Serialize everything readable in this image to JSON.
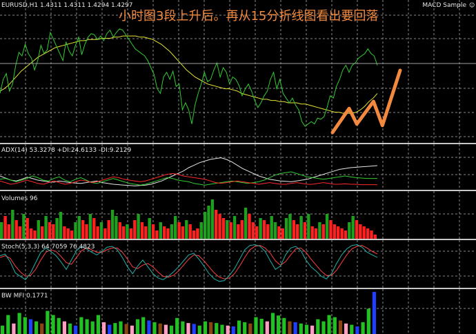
{
  "header": {
    "symbol_line": "EURUSD,H1  1.4311 1.4311 1.4294 1.4297",
    "expert_label": "MACD Sample",
    "annotation": "小时图3段上升后。再从15分折线图看出要回落"
  },
  "indicators": {
    "adx_label": "ADX(14) 53.3278 +DI:24.6133 -DI:9.2129",
    "volumes_label": "Volumes 96",
    "stoch_label": "Stoch(5,3,3) 64.7059 76.4823",
    "bwmfi_label": "BW MFI 0.1771"
  },
  "colors": {
    "price": "#32cd32",
    "ma": "#e6e632",
    "arrow": "#f2893f",
    "adx_main": "#e6e6e6",
    "plus_di": "#32cd32",
    "minus_di": "#ff2a2a",
    "vol_up": "#1ea01e",
    "vol_down": "#ff2020",
    "stoch_main": "#20b2aa",
    "stoch_signal": "#ff4040",
    "bw_green": "#22c022",
    "bw_brown": "#8b4513",
    "bw_blue": "#2040ff",
    "bw_pink": "#ff9ec0",
    "grid": "#8a8a8a"
  },
  "chart_data": [
    {
      "type": "line",
      "title": "EURUSD,H1",
      "y_range_note": "relative scale 0 (bottom) to 100 (top)",
      "series": [
        {
          "values": [
            38,
            50,
            55,
            40,
            46,
            62,
            73,
            70,
            80,
            72,
            68,
            58,
            66,
            79,
            72,
            75,
            90,
            84,
            78,
            72,
            66,
            82,
            74,
            70,
            79,
            86,
            71,
            80,
            86,
            89,
            88,
            84,
            87,
            83,
            89,
            92,
            86,
            90,
            93,
            92,
            88,
            84,
            80,
            76,
            74,
            72,
            70,
            66,
            60,
            54,
            42,
            38,
            52,
            56,
            50,
            57,
            44,
            46,
            24,
            30,
            24,
            12,
            28,
            38,
            46,
            56,
            48,
            50,
            58,
            64,
            52,
            60,
            56,
            46,
            52,
            50,
            45,
            36,
            42,
            46,
            40,
            32,
            26,
            30,
            36,
            40,
            50,
            56,
            42,
            50,
            38,
            34,
            30,
            34,
            28,
            24,
            14,
            10,
            12,
            14,
            12,
            17,
            16,
            18,
            26,
            36,
            34,
            44,
            50,
            58,
            62,
            56,
            62,
            64,
            68,
            70,
            72,
            76,
            72,
            70,
            62
          ]
        },
        {
          "values": [
            40,
            42,
            45,
            49,
            53,
            57,
            60,
            63,
            66,
            69,
            71,
            73,
            75,
            77,
            78,
            79,
            80,
            81,
            82,
            83,
            83,
            84,
            84,
            84,
            85,
            85,
            85,
            86,
            86,
            87,
            87,
            87,
            87,
            86,
            86,
            85,
            84,
            82,
            80,
            77,
            74,
            70,
            66,
            62,
            58,
            55,
            52,
            50,
            48,
            46,
            45,
            44,
            43,
            42,
            42,
            41,
            40,
            38,
            37,
            36,
            35,
            34,
            33,
            33,
            32,
            32,
            31,
            31,
            30,
            30,
            30,
            29,
            29,
            28,
            27,
            26,
            25,
            24,
            23,
            22,
            22,
            21,
            21,
            21,
            22,
            24,
            27,
            31,
            34,
            38
          ]
        }
      ],
      "arrow_path": [
        [
          0,
          0
        ],
        [
          15,
          34
        ],
        [
          22,
          12
        ],
        [
          37,
          44
        ],
        [
          45,
          10
        ],
        [
          61,
          88
        ]
      ]
    },
    {
      "type": "line",
      "title": "ADX(14)",
      "series": [
        {
          "values": [
            30,
            25,
            20,
            18,
            22,
            27,
            24,
            20,
            18,
            16,
            15,
            18,
            16,
            14,
            13,
            12,
            14,
            16,
            18,
            14,
            12,
            10,
            9,
            8,
            7,
            6,
            7,
            8,
            10,
            14,
            18,
            24,
            30,
            36,
            42,
            50,
            56,
            62,
            66,
            70,
            72,
            74,
            70,
            64,
            56,
            48,
            42,
            36,
            30,
            26,
            22,
            20,
            18,
            17,
            16,
            18,
            20,
            22,
            26,
            30,
            34,
            38,
            42,
            46,
            48,
            50,
            51,
            52,
            53,
            54,
            55
          ]
        },
        {
          "values": [
            22,
            24,
            20,
            16,
            20,
            24,
            30,
            26,
            20,
            18,
            24,
            28,
            20,
            16,
            22,
            26,
            20,
            14,
            12,
            16,
            20,
            24,
            20,
            16,
            12,
            10,
            8,
            10,
            14,
            18,
            22,
            26,
            24,
            20,
            18,
            16,
            12,
            10,
            8,
            10,
            12,
            14,
            16,
            18,
            16,
            14,
            12,
            14,
            16,
            20,
            26,
            32,
            36,
            38,
            40,
            36,
            32,
            28,
            26,
            24,
            22,
            24,
            26,
            28,
            30,
            28,
            26,
            25,
            24,
            24,
            24
          ]
        },
        {
          "values": [
            18,
            14,
            10,
            12,
            16,
            20,
            16,
            12,
            10,
            14,
            18,
            14,
            10,
            12,
            16,
            20,
            18,
            14,
            16,
            20,
            24,
            28,
            26,
            22,
            20,
            18,
            16,
            18,
            22,
            26,
            30,
            34,
            36,
            34,
            30,
            28,
            26,
            24,
            22,
            18,
            14,
            12,
            14,
            16,
            18,
            16,
            14,
            12,
            10,
            12,
            14,
            12,
            10,
            10,
            12,
            14,
            12,
            10,
            10,
            12,
            14,
            12,
            10,
            10,
            11,
            10,
            10,
            9,
            9,
            9,
            9
          ]
        }
      ]
    },
    {
      "type": "bar",
      "title": "Volumes",
      "series": [
        {
          "values": [
            40,
            55,
            35,
            70,
            45,
            30,
            60,
            50,
            25,
            20,
            45,
            30,
            55,
            40,
            35,
            50,
            65,
            30,
            25,
            20,
            40,
            55,
            45,
            35,
            60,
            50,
            30,
            40,
            25,
            45,
            70,
            55,
            40,
            30,
            35,
            25,
            45,
            60,
            40,
            30,
            50,
            35,
            20,
            40,
            30,
            25,
            35,
            55,
            40,
            30,
            45,
            35,
            20,
            25,
            40,
            65,
            80,
            95,
            70,
            60,
            50,
            45,
            40,
            55,
            35,
            45,
            75,
            60,
            40,
            30,
            50,
            45,
            35,
            55,
            40,
            30,
            25,
            50,
            60,
            45,
            35,
            55,
            40,
            60,
            30,
            25,
            40,
            35,
            60,
            45,
            35,
            30,
            25,
            20,
            40,
            55,
            45,
            35,
            30,
            25,
            20,
            10
          ]
        },
        {
          "up": [
            1,
            0,
            0,
            1,
            0,
            0,
            1,
            0,
            0,
            0,
            1,
            0,
            1,
            0,
            0,
            1,
            1,
            0,
            0,
            0,
            1,
            1,
            0,
            0,
            1,
            0,
            0,
            1,
            0,
            0,
            1,
            1,
            0,
            0,
            1,
            0,
            0,
            1,
            0,
            0,
            1,
            0,
            0,
            1,
            0,
            0,
            1,
            1,
            0,
            0,
            1,
            0,
            0,
            0,
            1,
            1,
            1,
            1,
            0,
            0,
            0,
            1,
            0,
            1,
            0,
            0,
            1,
            0,
            0,
            0,
            1,
            0,
            0,
            1,
            1,
            0,
            0,
            1,
            1,
            0,
            0,
            1,
            0,
            1,
            0,
            0,
            1,
            0,
            1,
            0,
            0,
            0,
            0,
            0,
            1,
            1,
            0,
            0,
            0,
            0,
            0,
            0
          ]
        }
      ]
    },
    {
      "type": "line",
      "title": "Stoch(5,3,3)",
      "series": [
        {
          "values": [
            70,
            74,
            56,
            30,
            22,
            14,
            30,
            54,
            78,
            88,
            80,
            70,
            55,
            38,
            60,
            82,
            92,
            86,
            78,
            72,
            80,
            90,
            92,
            84,
            66,
            44,
            28,
            46,
            60,
            44,
            28,
            18,
            14,
            22,
            32,
            44,
            58,
            72,
            76,
            62,
            46,
            28,
            16,
            10,
            12,
            24,
            40,
            62,
            84,
            94,
            96,
            92,
            80,
            58,
            38,
            46,
            72,
            88,
            92,
            82,
            60,
            44,
            34,
            22,
            16,
            28,
            52,
            72,
            86,
            94,
            96,
            90,
            78,
            72,
            66
          ]
        },
        {
          "values": [
            66,
            70,
            64,
            46,
            32,
            22,
            24,
            38,
            60,
            78,
            84,
            80,
            68,
            54,
            50,
            66,
            82,
            88,
            84,
            78,
            78,
            84,
            88,
            88,
            78,
            62,
            44,
            40,
            48,
            52,
            44,
            32,
            22,
            20,
            24,
            34,
            48,
            62,
            72,
            70,
            58,
            44,
            30,
            20,
            16,
            18,
            28,
            46,
            66,
            84,
            92,
            94,
            88,
            76,
            58,
            48,
            56,
            72,
            86,
            88,
            78,
            62,
            48,
            34,
            24,
            24,
            36,
            54,
            72,
            86,
            92,
            94,
            88,
            80,
            74
          ]
        }
      ]
    },
    {
      "type": "bar",
      "title": "BW MFI",
      "series": [
        {
          "values": [
            20,
            45,
            25,
            50,
            40,
            35,
            30,
            25,
            55,
            45,
            38,
            30,
            25,
            20,
            40,
            35,
            30,
            45,
            28,
            22,
            26,
            30,
            24,
            20,
            35,
            40,
            32,
            28,
            25,
            22,
            20,
            38,
            30,
            26,
            24,
            20,
            30,
            28,
            26,
            22,
            20,
            18,
            32,
            28,
            25,
            40,
            36,
            30,
            50,
            44,
            38,
            30,
            28,
            25,
            22,
            20,
            35,
            30,
            45,
            40,
            32,
            25,
            22,
            18,
            28,
            60,
            100
          ]
        },
        {
          "colors": [
            "green",
            "green",
            "pink",
            "green",
            "green",
            "blue",
            "green",
            "brown",
            "green",
            "green",
            "green",
            "pink",
            "green",
            "blue",
            "green",
            "green",
            "green",
            "green",
            "pink",
            "blue",
            "green",
            "green",
            "brown",
            "pink",
            "green",
            "green",
            "blue",
            "green",
            "brown",
            "pink",
            "green",
            "green",
            "green",
            "pink",
            "blue",
            "green",
            "green",
            "brown",
            "green",
            "green",
            "pink",
            "blue",
            "green",
            "green",
            "brown",
            "green",
            "green",
            "pink",
            "green",
            "green",
            "green",
            "brown",
            "blue",
            "green",
            "green",
            "pink",
            "green",
            "green",
            "green",
            "green",
            "brown",
            "pink",
            "green",
            "blue",
            "green",
            "green",
            "blue"
          ]
        }
      ]
    }
  ]
}
